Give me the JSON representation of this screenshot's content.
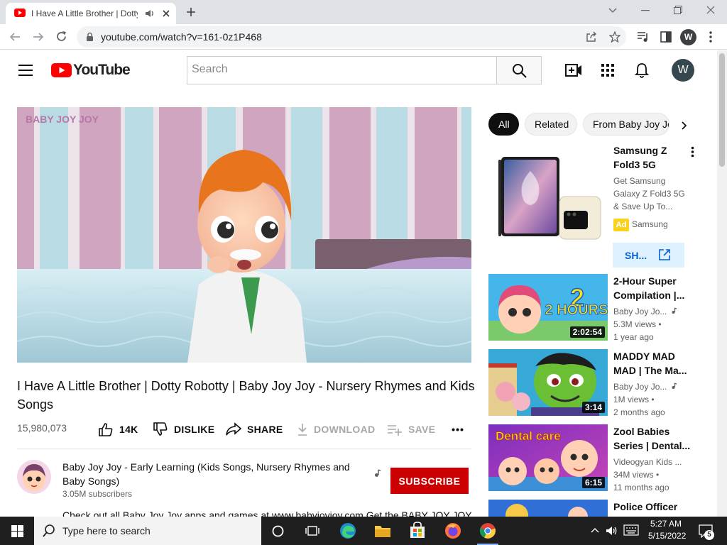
{
  "browser": {
    "tab_title": "I Have A Little Brother | Dotty",
    "url": "youtube.com/watch?v=161-0z1P468",
    "profile_initial": "W"
  },
  "youtube": {
    "logo_text": "YouTube",
    "search_placeholder": "Search",
    "avatar_initial": "W"
  },
  "video": {
    "watermark": "BABY JOY JOY",
    "title": "I Have A Little Brother | Dotty Robotty | Baby Joy Joy - Nursery Rhymes and Kids Songs",
    "views": "15,980,073",
    "actions": {
      "likes": "14K",
      "dislike": "DISLIKE",
      "share": "SHARE",
      "download": "DOWNLOAD",
      "save": "SAVE"
    },
    "channel_name": "Baby Joy Joy - Early Learning (Kids Songs, Nursery Rhymes and Baby Songs)",
    "subscribers": "3.05M subscribers",
    "subscribe_label": "SUBSCRIBE",
    "description": "Check out all Baby Joy Joy apps and games at www.babyjoyjoy.com Get the BABY JOY JOY"
  },
  "chips": [
    "All",
    "Related",
    "From Baby Joy Joy"
  ],
  "ad": {
    "title": "Samsung Z Fold3 5G",
    "description": "Get Samsung Galaxy Z Fold3 5G & Save Up To...",
    "badge": "Ad",
    "advertiser": "Samsung",
    "cta": "SH..."
  },
  "recommendations": [
    {
      "title": "2-Hour Super Compilation |...",
      "channel": "Baby Joy Jo...",
      "views": "5.3M views •",
      "age": "1 year ago",
      "duration": "2:02:54",
      "thumb_text": "2 HOURS"
    },
    {
      "title": "MADDY MAD MAD | The Ma...",
      "channel": "Baby Joy Jo...",
      "views": "1M views •",
      "age": "2 months ago",
      "duration": "3:14"
    },
    {
      "title": "Zool Babies Series | Dental...",
      "channel": "Videogyan Kids ...",
      "views": "34M views •",
      "age": "11 months ago",
      "duration": "6:15",
      "thumb_text": "Dental care"
    },
    {
      "title": "Police Officer"
    }
  ],
  "taskbar": {
    "search_placeholder": "Type here to search",
    "time": "5:27 AM",
    "date": "5/15/2022",
    "notification_count": "5"
  },
  "colors": {
    "youtube_red": "#ff0000",
    "subscribe_red": "#cc0000",
    "link_blue": "#065fd4",
    "taskbar": "#1f1f1f"
  }
}
